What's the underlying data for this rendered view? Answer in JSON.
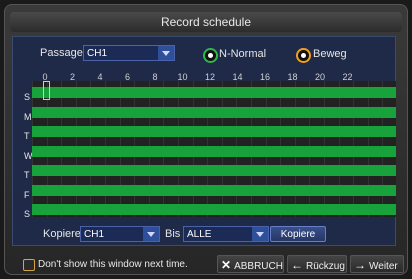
{
  "title": "Record schedule",
  "passage": {
    "label": "Passage",
    "value": "CH1"
  },
  "modes": [
    {
      "label": "N-Normal",
      "color": "#2fb84a",
      "selected": true
    },
    {
      "label": "Beweg",
      "color": "#f0a020",
      "selected": false
    }
  ],
  "hours": [
    "0",
    "2",
    "4",
    "6",
    "8",
    "10",
    "12",
    "14",
    "16",
    "18",
    "20",
    "22"
  ],
  "days": [
    "S",
    "M",
    "T",
    "W",
    "T",
    "F",
    "S"
  ],
  "record_color": "#18a23b",
  "copy": {
    "label": "Kopiere",
    "from": "CH1",
    "to_label": "Bis",
    "to": "ALLE",
    "button": "Kopiere"
  },
  "footer": {
    "checkbox_label": "Don't show this window next time.",
    "cancel": "ABBRUCH",
    "back": "Rückzug",
    "next": "Weiter"
  }
}
